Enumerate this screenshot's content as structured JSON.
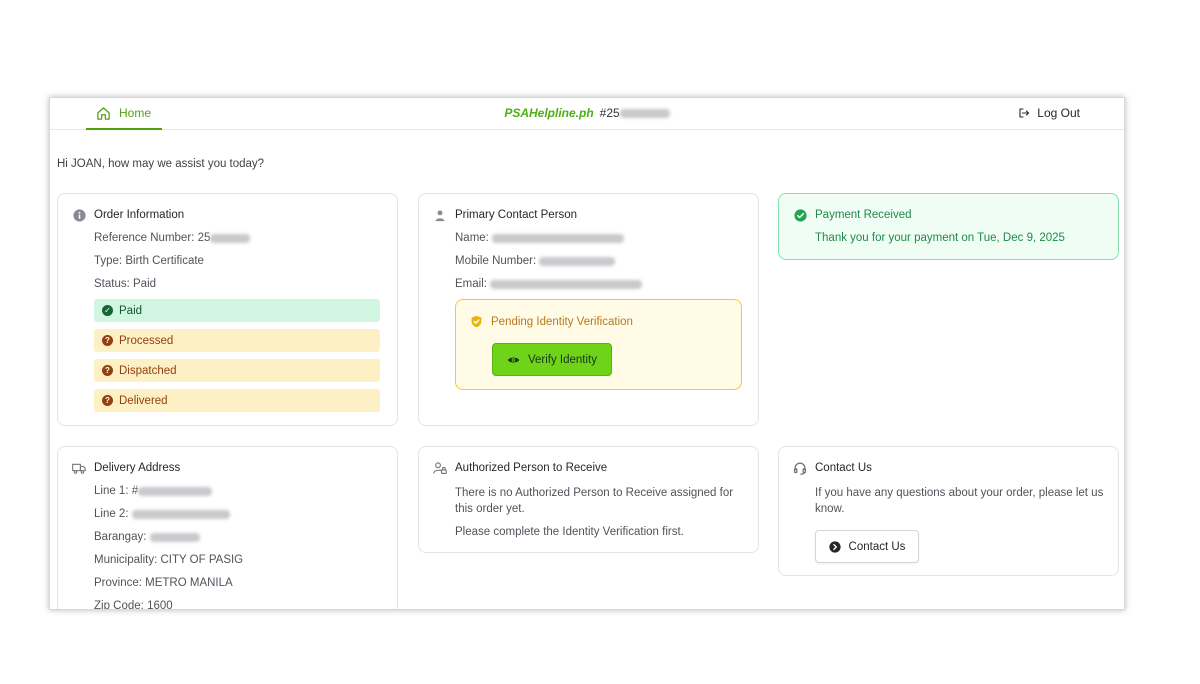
{
  "header": {
    "home_label": "Home",
    "brand_name": "PSAHelpline.ph",
    "order_prefix": "#25",
    "logout_label": "Log Out"
  },
  "greeting": "Hi JOAN, how may we assist you today?",
  "order_info": {
    "title": "Order Information",
    "reference_label": "Reference Number:",
    "reference_value_prefix": "25",
    "type_label": "Type:",
    "type_value": "Birth Certificate",
    "status_label": "Status:",
    "status_value": "Paid",
    "steps": [
      {
        "label": "Paid",
        "state": "done"
      },
      {
        "label": "Processed",
        "state": "pending"
      },
      {
        "label": "Dispatched",
        "state": "pending"
      },
      {
        "label": "Delivered",
        "state": "pending"
      }
    ]
  },
  "contact_person": {
    "title": "Primary Contact Person",
    "name_label": "Name:",
    "mobile_label": "Mobile Number:",
    "email_label": "Email:",
    "verification_title": "Pending Identity Verification",
    "verify_button": "Verify Identity"
  },
  "payment": {
    "title": "Payment Received",
    "message": "Thank you for your payment on Tue, Dec 9, 2025"
  },
  "delivery": {
    "title": "Delivery Address",
    "line1_label": "Line 1:",
    "line1_prefix": "#",
    "line2_label": "Line 2:",
    "barangay_label": "Barangay:",
    "municipality_label": "Municipality:",
    "municipality_value": "CITY OF PASIG",
    "province_label": "Province:",
    "province_value": "METRO MANILA",
    "zip_label": "Zip Code:",
    "zip_value": "1600"
  },
  "authorized": {
    "title": "Authorized Person to Receive",
    "line1": "There is no Authorized Person to Receive assigned for this order yet.",
    "line2": "Please complete the Identity Verification first."
  },
  "contact_us": {
    "title": "Contact Us",
    "message": "If you have any questions about your order, please let us know.",
    "button": "Contact Us"
  },
  "colors": {
    "brand_green": "#54a00e",
    "paid_bg": "#d1f7e2",
    "pending_bg": "#fdf0c4",
    "verify_button_bg": "#6fd31a",
    "payment_bg": "#f0fdf5"
  }
}
